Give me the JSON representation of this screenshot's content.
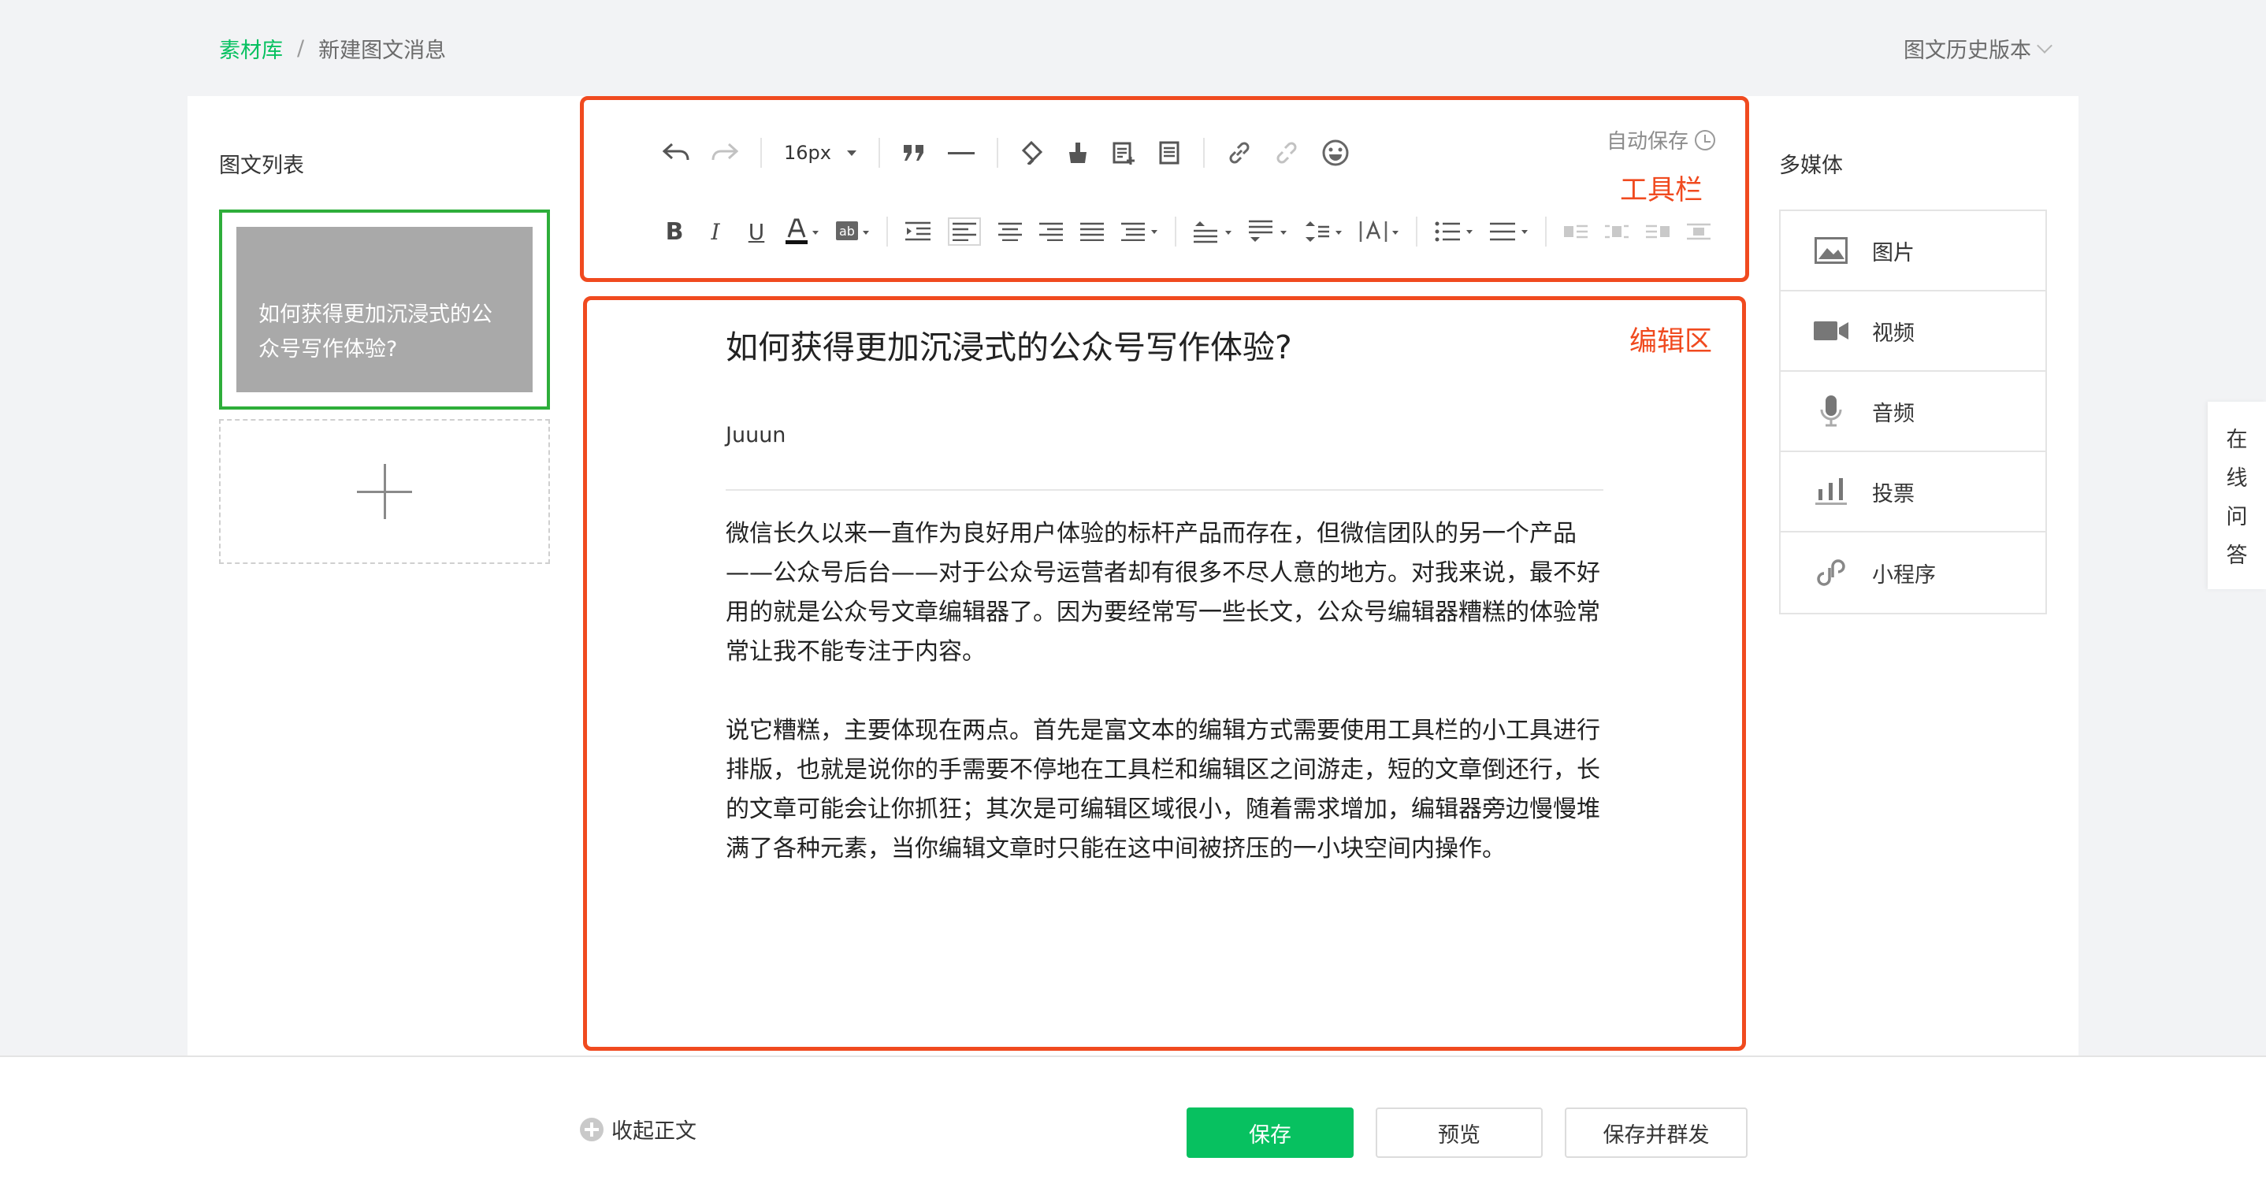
{
  "breadcrumb": {
    "root": "素材库",
    "separator": "/",
    "current": "新建图文消息"
  },
  "history": {
    "label": "图文历史版本"
  },
  "left_panel": {
    "title": "图文列表",
    "articles": [
      {
        "title": "如何获得更加沉浸式的公众号写作体验?"
      }
    ]
  },
  "toolbar": {
    "font_size": "16px",
    "autosave": "自动保存",
    "annotation": "工具栏",
    "row1_icons": [
      "undo-icon",
      "redo-icon",
      "font-size-select",
      "blockquote-icon",
      "horizontal-rule-icon",
      "format-brush-icon",
      "clear-format-icon",
      "insert-template-icon",
      "template-icon",
      "link-icon",
      "unlink-icon",
      "emoji-icon"
    ],
    "row2_icons": [
      "bold-icon",
      "italic-icon",
      "underline-icon",
      "font-color-icon",
      "background-color-icon",
      "indent-icon",
      "align-left-icon",
      "align-center-icon",
      "align-right-icon",
      "align-justify-icon",
      "paragraph-spacing-icon",
      "spacing-before-icon",
      "spacing-after-icon",
      "line-height-icon",
      "letter-spacing-icon",
      "ordered-list-icon",
      "unordered-list-icon",
      "float-left-icon",
      "float-none-icon",
      "float-right-icon",
      "float-center-icon"
    ]
  },
  "editor": {
    "annotation": "编辑区",
    "title": "如何获得更加沉浸式的公众号写作体验?",
    "author": "Juuun",
    "paragraphs": [
      "微信长久以来一直作为良好用户体验的标杆产品而存在，但微信团队的另一个产品——公众号后台——对于公众号运营者却有很多不尽人意的地方。对我来说，最不好用的就是公众号文章编辑器了。因为要经常写一些长文，公众号编辑器糟糕的体验常常让我不能专注于内容。",
      "说它糟糕，主要体现在两点。首先是富文本的编辑方式需要使用工具栏的小工具进行排版，也就是说你的手需要不停地在工具栏和编辑区之间游走，短的文章倒还行，长的文章可能会让你抓狂；其次是可编辑区域很小，随着需求增加，编辑器旁边慢慢堆满了各种元素，当你编辑文章时只能在这中间被挤压的一小块空间内操作。"
    ]
  },
  "media": {
    "title": "多媒体",
    "items": [
      {
        "label": "图片",
        "icon": "image-icon"
      },
      {
        "label": "视频",
        "icon": "video-icon"
      },
      {
        "label": "音频",
        "icon": "audio-icon"
      },
      {
        "label": "投票",
        "icon": "vote-icon"
      },
      {
        "label": "小程序",
        "icon": "mini-program-icon"
      }
    ]
  },
  "online_qa": {
    "chars": [
      "在",
      "线",
      "问",
      "答"
    ]
  },
  "bottom": {
    "collapse": "收起正文",
    "save": "保存",
    "preview": "预览",
    "save_publish": "保存并群发"
  },
  "colors": {
    "accent": "#07c160",
    "annotation": "#f04a1f",
    "selected_border": "#2eae3a"
  }
}
